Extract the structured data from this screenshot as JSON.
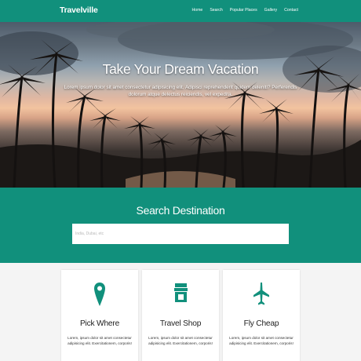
{
  "brand": {
    "name": "Travelville"
  },
  "nav": {
    "items": [
      {
        "label": "Home"
      },
      {
        "label": "Search"
      },
      {
        "label": "Popular Places"
      },
      {
        "label": "Gallery"
      },
      {
        "label": "Contact"
      }
    ]
  },
  "hero": {
    "title": "Take Your Dream Vacation",
    "subtitle": "Lorem ipsum dolor sit amet consectetur adipisicing elit. Adipisci reprehenderit quidem deleniti? Perferendis dolorum atque delectus reiciendis, vel expedita."
  },
  "search": {
    "title": "Search Destination",
    "placeholder": "India, Dubai, etc",
    "value": ""
  },
  "features": [
    {
      "icon": "map-marker-icon",
      "title": "Pick Where",
      "text": "Lorem, ipsum dolor sit amet consectetur adipisicing elit. Exercitationem, corporis!"
    },
    {
      "icon": "store-icon",
      "title": "Travel Shop",
      "text": "Lorem, ipsum dolor sit amet consectetur adipisicing elit. Exercitationem, corporis!"
    },
    {
      "icon": "plane-icon",
      "title": "Fly Cheap",
      "text": "Lorem, ipsum dolor sit amet consectetur adipisicing elit. Exercitationem, corporis!"
    }
  ],
  "colors": {
    "primary": "#11907c",
    "background": "#f4f4f4",
    "card": "#ffffff"
  }
}
